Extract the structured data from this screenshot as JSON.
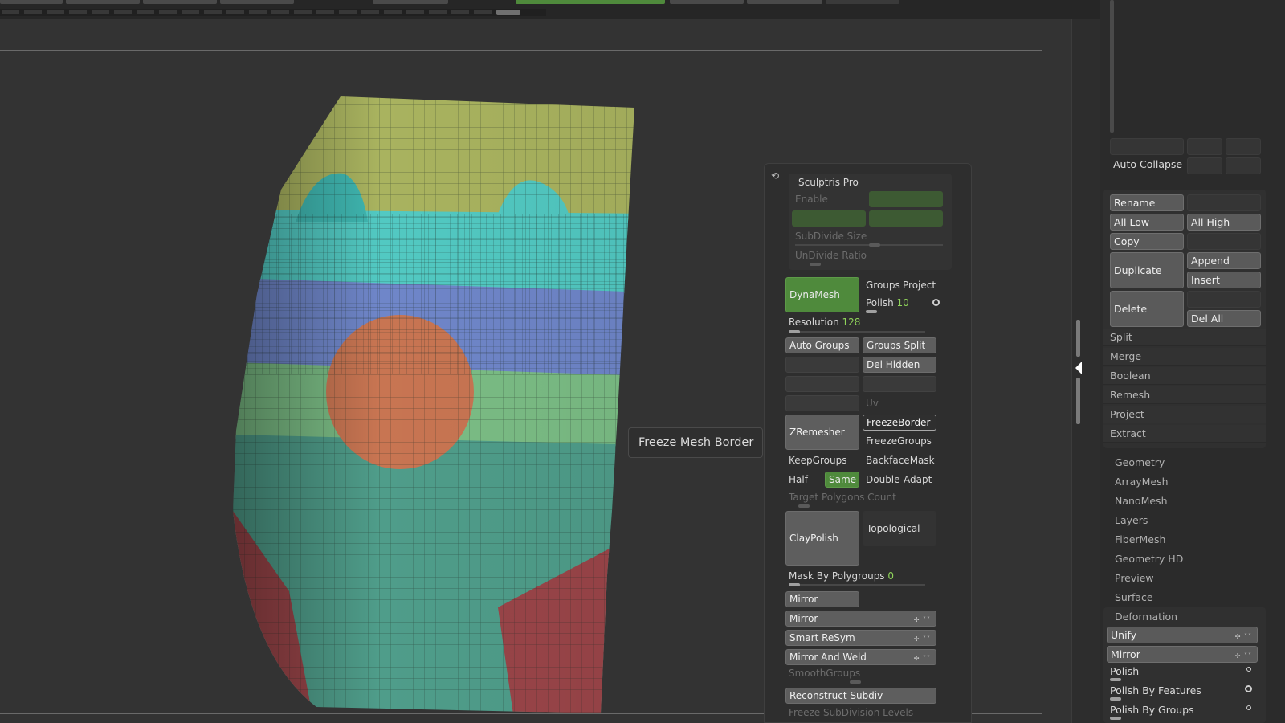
{
  "viewport": {
    "tooltip": "Freeze Mesh Border"
  },
  "palette": {
    "sculptris": {
      "title": "Sculptris Pro",
      "enable_label": "Enable",
      "subdivide_size_label": "SubDivide Size",
      "undivide_ratio_label": "UnDivide Ratio"
    },
    "dynamesh": {
      "button": "DynaMesh",
      "groups": "Groups",
      "project": "Project",
      "polish_label": "Polish",
      "polish_value": "10",
      "resolution_label": "Resolution",
      "resolution_value": "128",
      "auto_groups": "Auto Groups",
      "groups_split": "Groups Split",
      "del_hidden": "Del Hidden",
      "uv": "Uv"
    },
    "zremesher": {
      "button": "ZRemesher",
      "freeze_border": "FreezeBorder",
      "freeze_groups": "FreezeGroups",
      "keep_groups": "KeepGroups",
      "backface_mask": "BackfaceMask",
      "half": "Half",
      "same": "Same",
      "double": "Double",
      "adapt": "Adapt",
      "target_polygons_label": "Target Polygons Count"
    },
    "claypolish": {
      "button": "ClayPolish",
      "topological": "Topological",
      "mask_by_polygroups_label": "Mask By Polygroups",
      "mask_by_polygroups_value": "0"
    },
    "mirror_section": {
      "mirror_1": "Mirror",
      "mirror_2": "Mirror",
      "smart_resym": "Smart ReSym",
      "mirror_and_weld": "Mirror And Weld",
      "smooth_groups": "SmoothGroups",
      "reconstruct_subdiv": "Reconstruct Subdiv",
      "freeze_subdivision_levels": "Freeze SubDivision Levels"
    }
  },
  "right_panel": {
    "auto_collapse": "Auto Collapse",
    "subtool_buttons": {
      "rename": "Rename",
      "all_low": "All Low",
      "all_high": "All High",
      "copy": "Copy",
      "duplicate": "Duplicate",
      "append": "Append",
      "insert": "Insert",
      "delete": "Delete",
      "del_all": "Del All"
    },
    "subtool_sections": [
      "Split",
      "Merge",
      "Boolean",
      "Remesh",
      "Project",
      "Extract"
    ],
    "tool_menus": [
      "Geometry",
      "ArrayMesh",
      "NanoMesh",
      "Layers",
      "FiberMesh",
      "Geometry HD",
      "Preview",
      "Surface"
    ],
    "deformation": {
      "title": "Deformation",
      "unify": "Unify",
      "mirror": "Mirror",
      "polish": "Polish",
      "polish_by_features": "Polish By Features",
      "polish_by_groups": "Polish By Groups"
    }
  },
  "colors": {
    "accent_green": "#4f8a3c",
    "value_green": "#8fd35a",
    "polygroup_olive": "#a9b35f",
    "polygroup_cyan": "#52c9c2",
    "polygroup_blue": "#6f86c9",
    "polygroup_green": "#7bbd85",
    "polygroup_orange": "#c87552",
    "polygroup_teal": "#4f9d8a",
    "polygroup_maroon": "#9a4549"
  }
}
